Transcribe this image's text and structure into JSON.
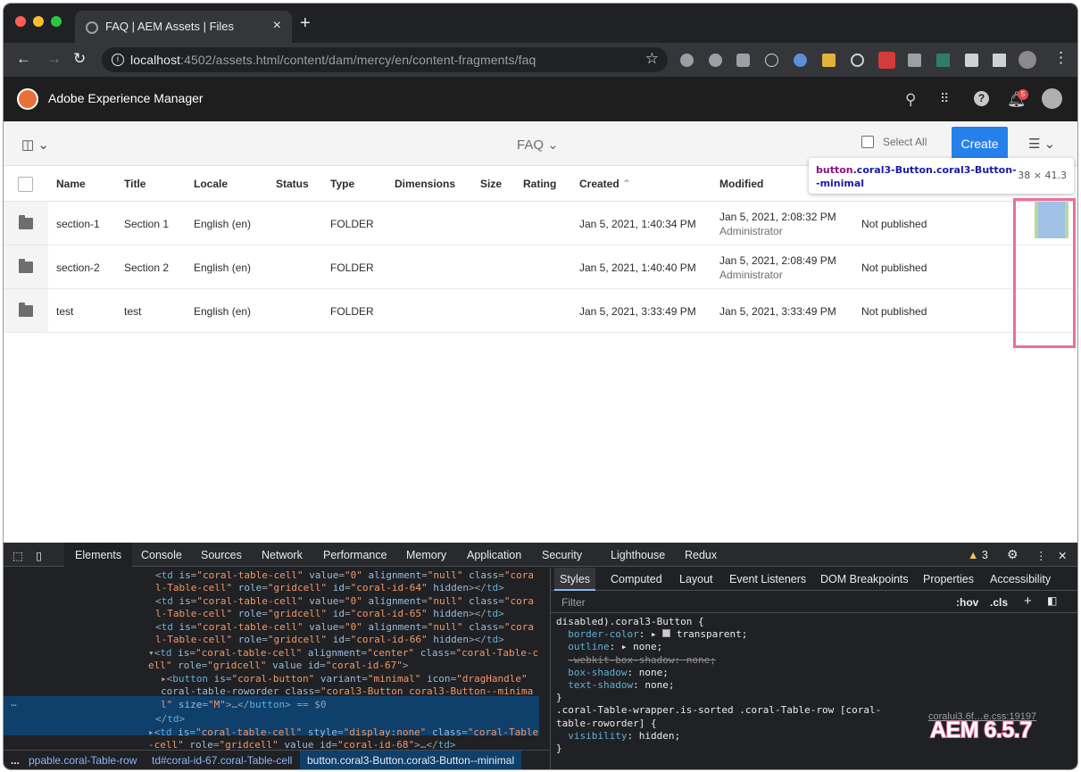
{
  "browser": {
    "tab_title": "FAQ | AEM Assets | Files",
    "url_host": "localhost",
    "url_rest": ":4502/assets.html/content/dam/mercy/en/content-fragments/faq"
  },
  "aem": {
    "brand": "Adobe Experience Manager",
    "notifications": "5"
  },
  "actionbar": {
    "folder_title": "FAQ",
    "select_all": "Select All",
    "create": "Create"
  },
  "table": {
    "headers": [
      "Name",
      "Title",
      "Locale",
      "Status",
      "Type",
      "Dimensions",
      "Size",
      "Rating",
      "Created",
      "Modified"
    ],
    "rows": [
      {
        "name": "section-1",
        "title": "Section 1",
        "locale": "English (en)",
        "type": "FOLDER",
        "created": "Jan 5, 2021, 1:40:34 PM",
        "modified": "Jan 5, 2021, 2:08:32 PM",
        "modified_by": "Administrator",
        "published": "Not published"
      },
      {
        "name": "section-2",
        "title": "Section 2",
        "locale": "English (en)",
        "type": "FOLDER",
        "created": "Jan 5, 2021, 1:40:40 PM",
        "modified": "Jan 5, 2021, 2:08:49 PM",
        "modified_by": "Administrator",
        "published": "Not published"
      },
      {
        "name": "test",
        "title": "test",
        "locale": "English (en)",
        "type": "FOLDER",
        "created": "Jan 5, 2021, 3:33:49 PM",
        "modified": "Jan 5, 2021, 3:33:49 PM",
        "modified_by": "",
        "published": "Not published"
      }
    ]
  },
  "inspector": {
    "selector_tag": "button",
    "selector_class": ".coral3-Button.coral3-Button--minimal",
    "dims": "38 × 41.3"
  },
  "devtools": {
    "tabs": [
      "Elements",
      "Console",
      "Sources",
      "Network",
      "Performance",
      "Memory",
      "Application",
      "Security",
      "Lighthouse",
      "Redux"
    ],
    "warnings": "3",
    "style_tabs": [
      "Styles",
      "Computed",
      "Layout",
      "Event Listeners",
      "DOM Breakpoints",
      "Properties",
      "Accessibility"
    ],
    "filter": "Filter",
    "hov": ":hov",
    "cls": ".cls",
    "source": "coralui3.6f…e.css:19197",
    "crumbs": [
      "...",
      "ppable.coral-Table-row",
      "td#coral-id-67.coral-Table-cell",
      "button.coral3-Button.coral3-Button--minimal"
    ],
    "badge": "AEM 6.5.7"
  }
}
